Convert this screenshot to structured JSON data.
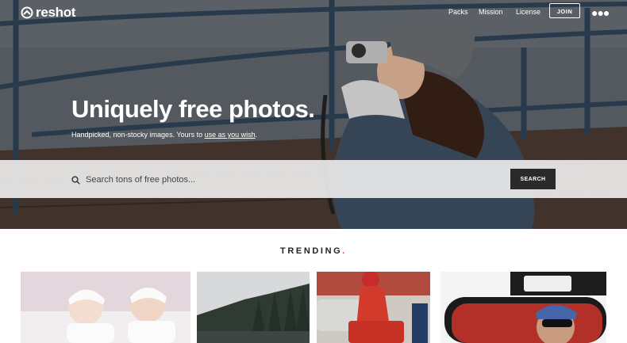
{
  "header": {
    "logo_text": "reshot",
    "nav": [
      "Packs",
      "Mission",
      "License"
    ],
    "join_label": "JOIN",
    "menu_icon": "more-dots-icon"
  },
  "hero": {
    "headline": "Uniquely free photos.",
    "subline_prefix": "Handpicked, non-stocky images. Yours to ",
    "subline_link": "use as you wish",
    "subline_suffix": "."
  },
  "search": {
    "placeholder": "Search tons of free photos...",
    "button_label": "SEARCH",
    "icon": "search-icon"
  },
  "trending": {
    "title": "TRENDING",
    "title_dot": ".",
    "photos": [
      "baby-twins-photo",
      "forest-fjord-photo",
      "scooter-rider-photo",
      "car-mirror-photo"
    ]
  },
  "colors": {
    "accent": "#e8423f",
    "button_dark": "#2a2a2a"
  }
}
